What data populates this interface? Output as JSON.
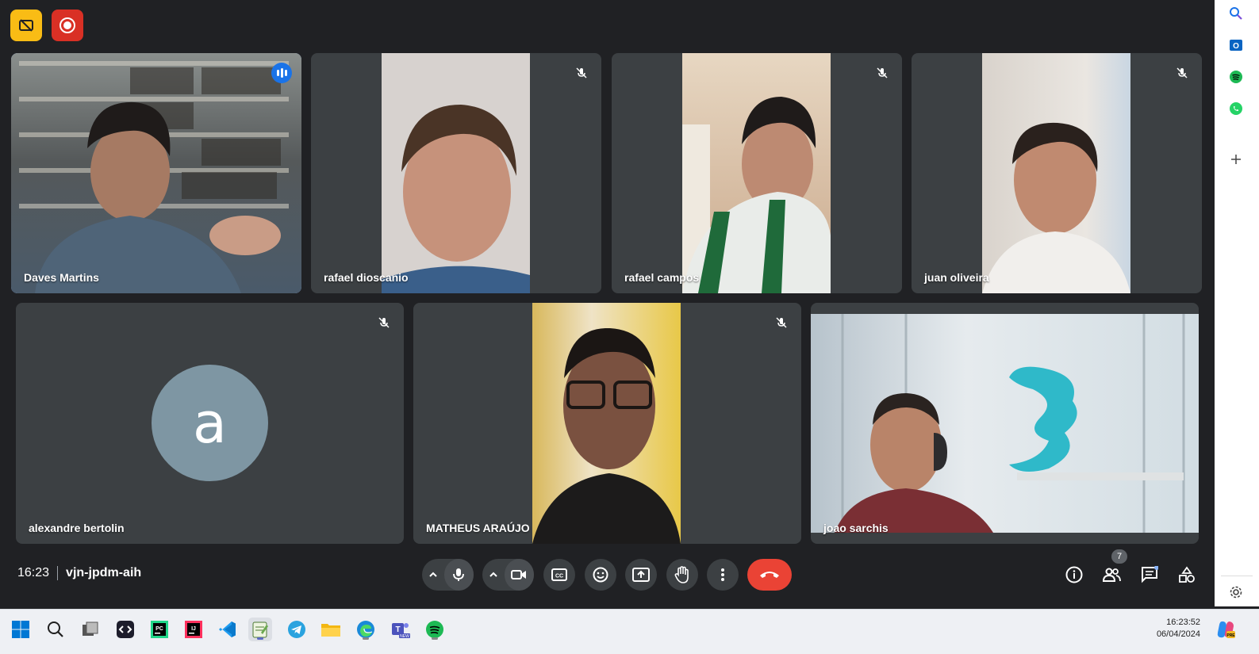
{
  "meeting": {
    "time": "16:23",
    "code": "vjn-jpdm-aih",
    "participant_count": "7"
  },
  "participants": [
    {
      "name": "Daves Martins",
      "speaking": true,
      "muted": false
    },
    {
      "name": "rafael dioscanio",
      "muted": true
    },
    {
      "name": "rafael campos",
      "muted": true
    },
    {
      "name": "juan oliveira",
      "muted": true
    },
    {
      "name": "alexandre bertolin",
      "muted": true,
      "avatar_letter": "a"
    },
    {
      "name": "MATHEUS ARAÚJO",
      "muted": true
    },
    {
      "name": "joao sarchis",
      "muted": false
    }
  ],
  "icons": {
    "top_left": [
      "no-video-badge-icon",
      "record-icon"
    ],
    "controls": [
      "chevron-up-icon",
      "mic-icon",
      "chevron-up-icon",
      "camera-icon",
      "captions-icon",
      "emoji-icon",
      "present-icon",
      "raise-hand-icon",
      "more-options-icon",
      "hang-up-icon"
    ],
    "right": [
      "info-icon",
      "people-icon",
      "chat-icon",
      "activities-icon"
    ],
    "side_panel": [
      "search-icon",
      "outlook-icon",
      "spotify-icon",
      "whatsapp-icon",
      "add-icon",
      "settings-icon"
    ],
    "taskbar": [
      "windows-start-icon",
      "search-icon",
      "task-view-icon",
      "devtoys-icon",
      "pycharm-icon",
      "intellij-icon",
      "vscode-icon",
      "notepad-icon",
      "telegram-icon",
      "file-explorer-icon",
      "edge-icon",
      "teams-icon",
      "spotify-icon",
      "copilot-icon"
    ]
  },
  "taskbar": {
    "clock_time": "16:23:52",
    "clock_date": "06/04/2024"
  },
  "colors": {
    "background": "#202124",
    "tile": "#3c4043",
    "active_outline": "#8ab4f8",
    "hangup": "#ea4335",
    "record": "#d93025",
    "badge": "#f9bc15"
  }
}
